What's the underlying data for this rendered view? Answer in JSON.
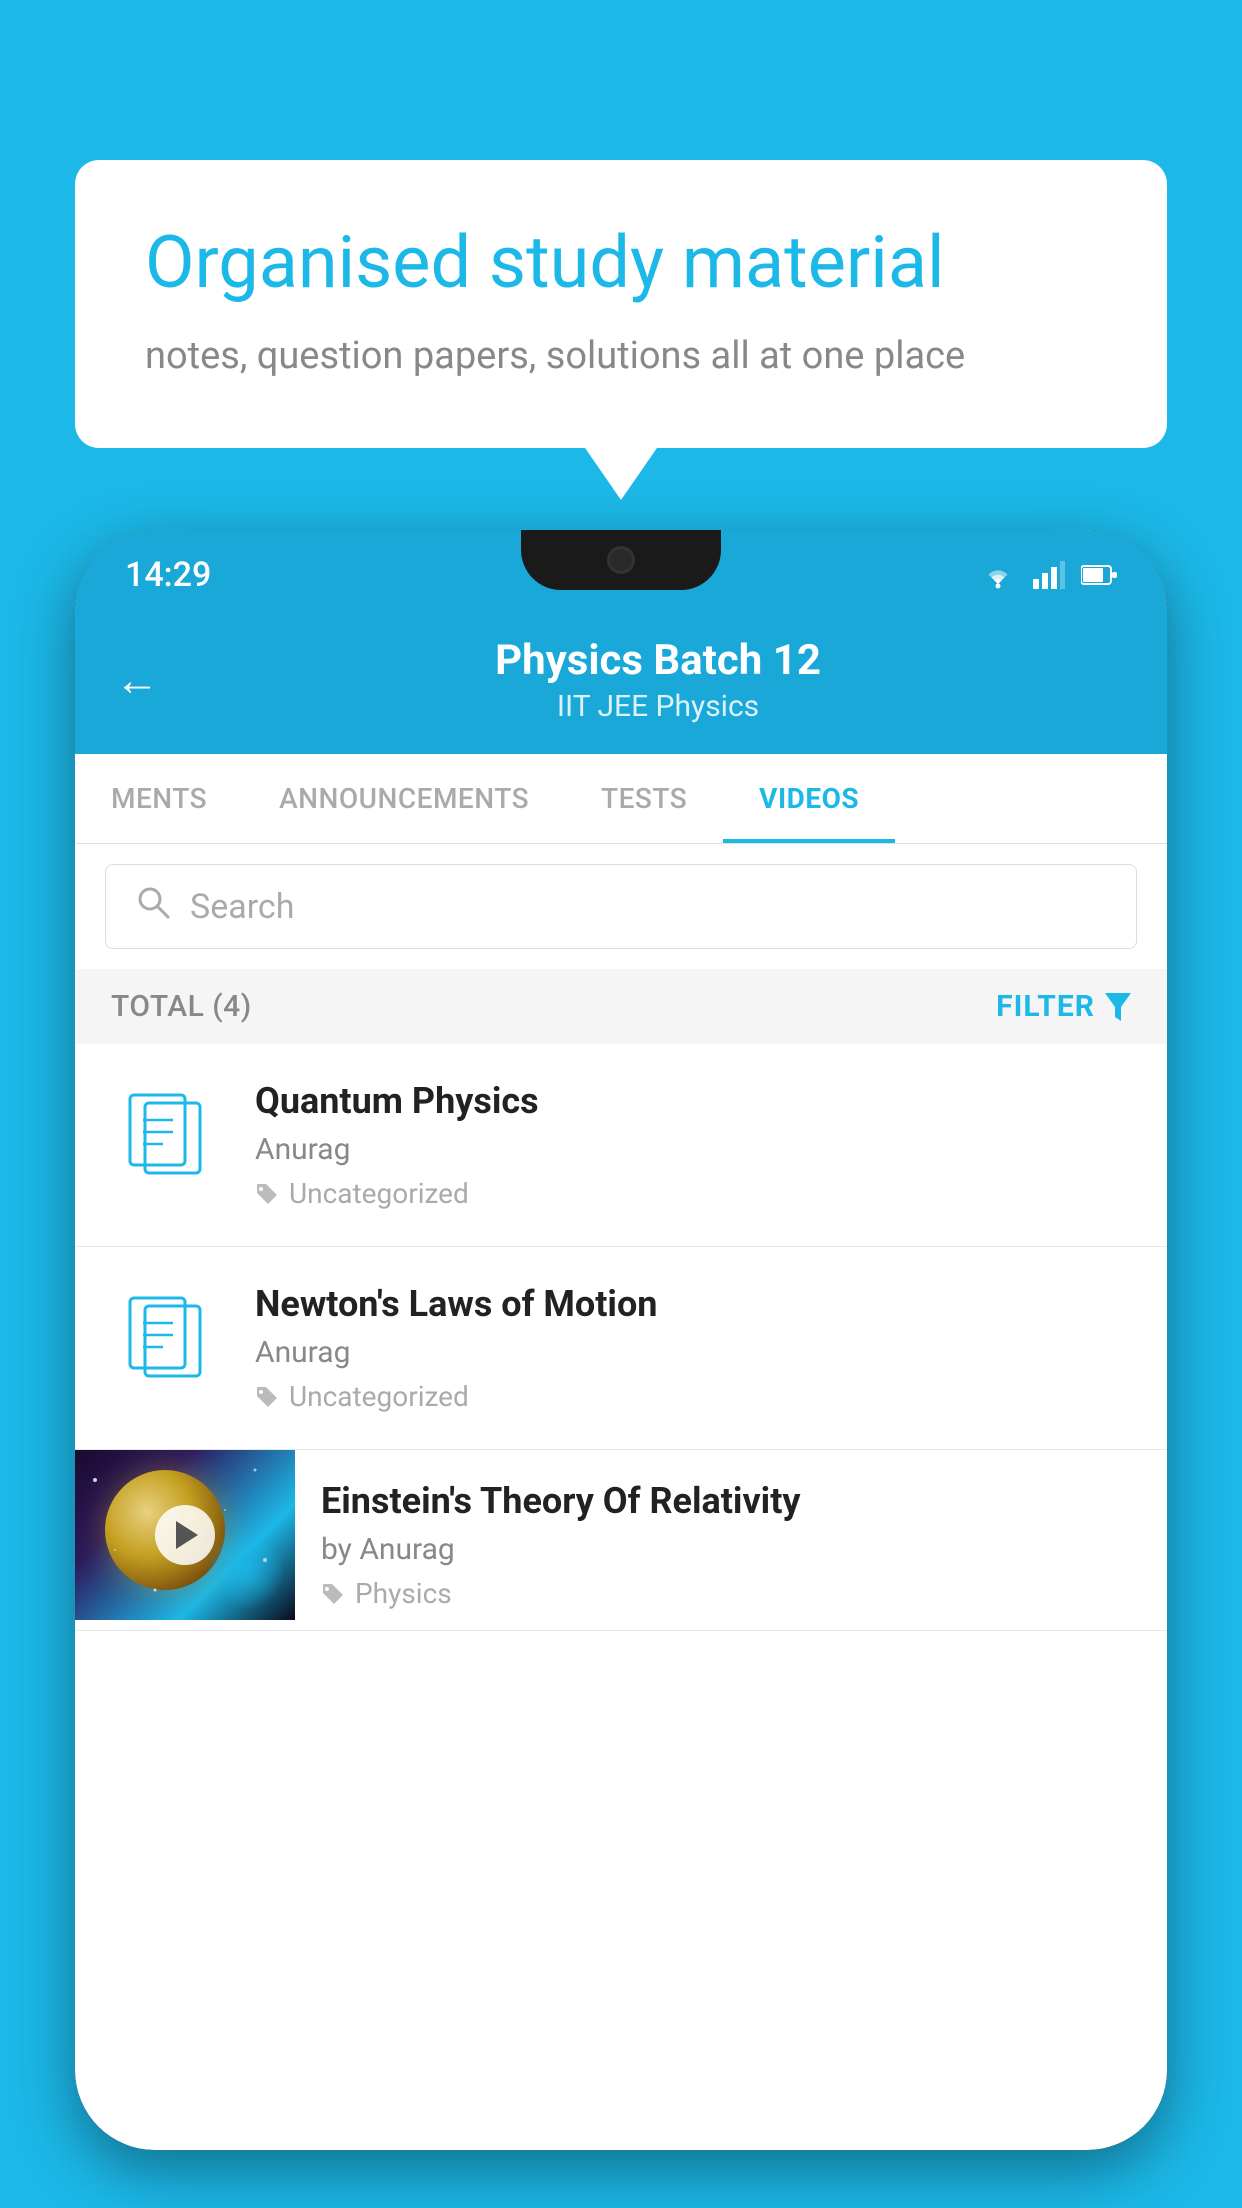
{
  "background_color": "#1CB8E8",
  "speech_bubble": {
    "title": "Organised study material",
    "subtitle": "notes, question papers, solutions all at one place"
  },
  "phone": {
    "status_bar": {
      "time": "14:29"
    },
    "header": {
      "title": "Physics Batch 12",
      "subtitle": "IIT JEE   Physics",
      "back_label": "←"
    },
    "tabs": [
      {
        "label": "MENTS",
        "active": false
      },
      {
        "label": "ANNOUNCEMENTS",
        "active": false
      },
      {
        "label": "TESTS",
        "active": false
      },
      {
        "label": "VIDEOS",
        "active": true
      }
    ],
    "search": {
      "placeholder": "Search"
    },
    "filter_bar": {
      "total_label": "TOTAL (4)",
      "filter_label": "FILTER"
    },
    "videos": [
      {
        "title": "Quantum Physics",
        "author": "Anurag",
        "tag": "Uncategorized",
        "type": "file"
      },
      {
        "title": "Newton's Laws of Motion",
        "author": "Anurag",
        "tag": "Uncategorized",
        "type": "file"
      },
      {
        "title": "Einstein's Theory Of Relativity",
        "author": "by Anurag",
        "tag": "Physics",
        "type": "video"
      }
    ]
  }
}
